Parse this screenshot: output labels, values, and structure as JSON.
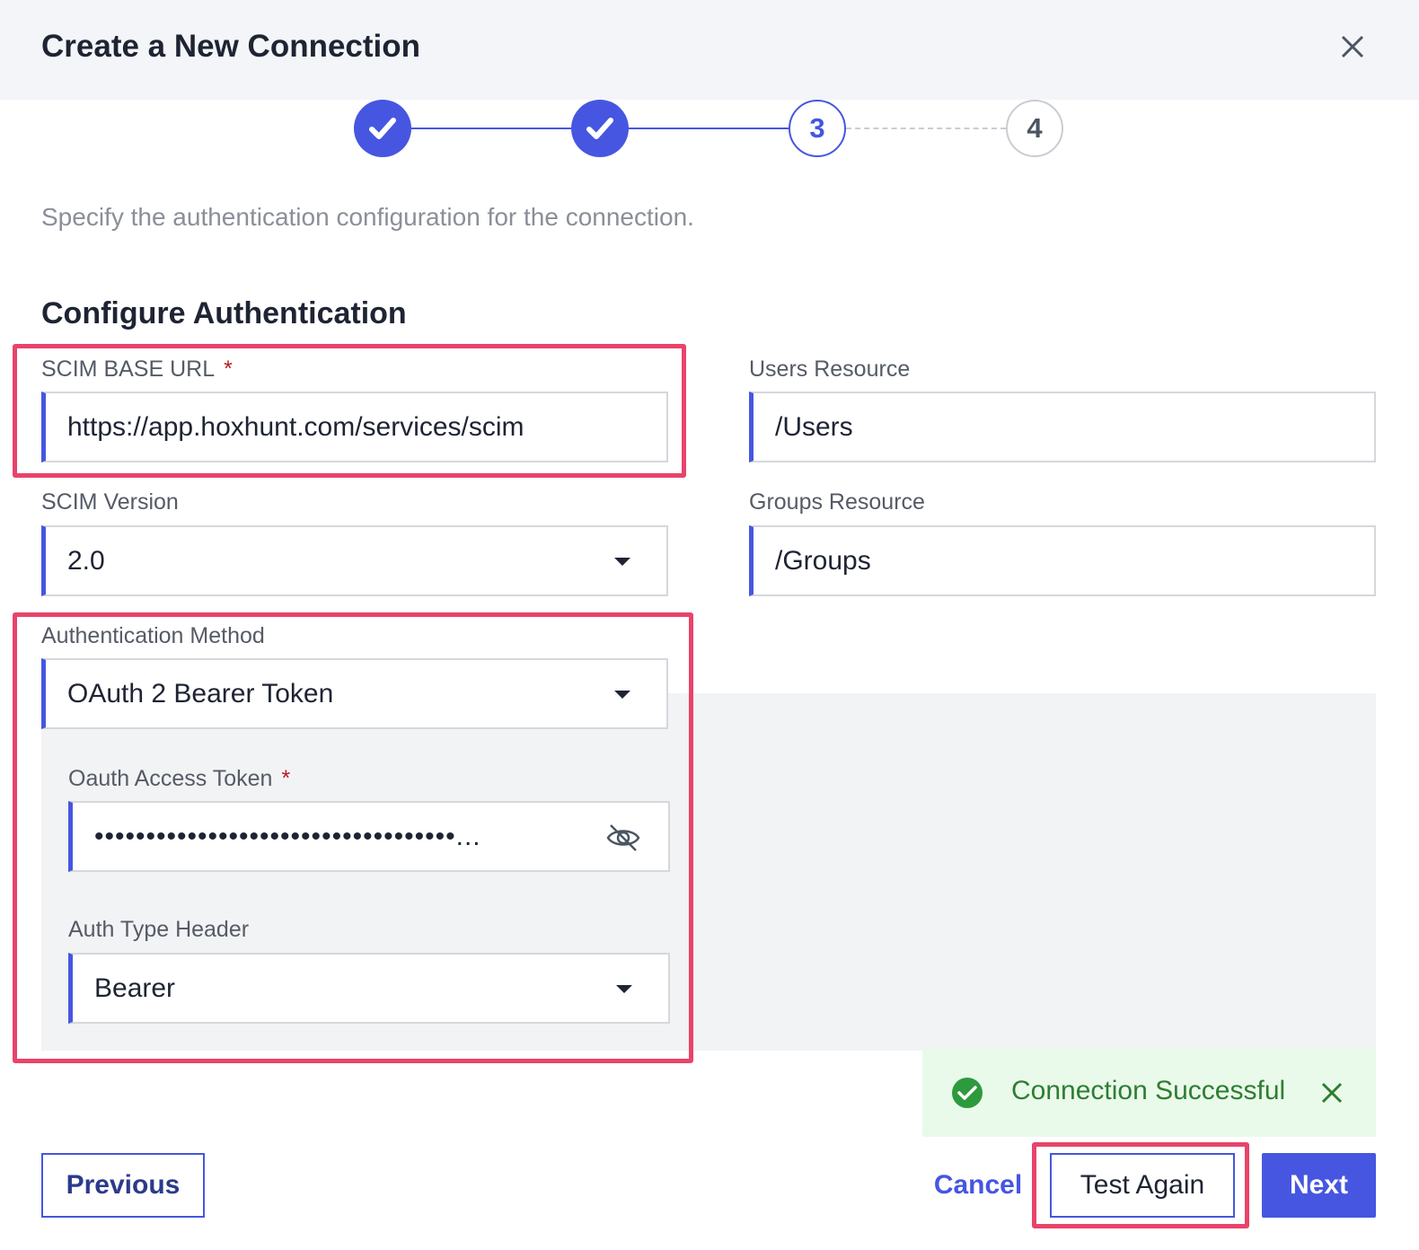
{
  "header": {
    "title": "Create a New Connection"
  },
  "stepper": {
    "step3": "3",
    "step4": "4"
  },
  "subtitle": "Specify the authentication configuration for the connection.",
  "section_title": "Configure Authentication",
  "fields": {
    "scim_base_url": {
      "label": "SCIM BASE URL",
      "required": "*",
      "value": "https://app.hoxhunt.com/services/scim"
    },
    "users_resource": {
      "label": "Users Resource",
      "value": "/Users"
    },
    "scim_version": {
      "label": "SCIM Version",
      "value": "2.0"
    },
    "groups_resource": {
      "label": "Groups Resource",
      "value": "/Groups"
    },
    "auth_method": {
      "label": "Authentication Method",
      "value": "OAuth 2 Bearer Token"
    },
    "oauth_token": {
      "label": "Oauth Access Token",
      "required": "*",
      "value": "•••••••••••••••••••••••••••••••••••..."
    },
    "auth_type_header": {
      "label": "Auth Type Header",
      "value": "Bearer"
    }
  },
  "toast": {
    "message": "Connection Successful",
    "status_color": "#2e9a3e"
  },
  "footer": {
    "previous_label": "Previous",
    "cancel_label": "Cancel",
    "test_again_label": "Test Again",
    "next_label": "Next"
  },
  "colors": {
    "accent": "#4656e0",
    "highlight": "#e8436b",
    "success": "#2e7d32"
  }
}
